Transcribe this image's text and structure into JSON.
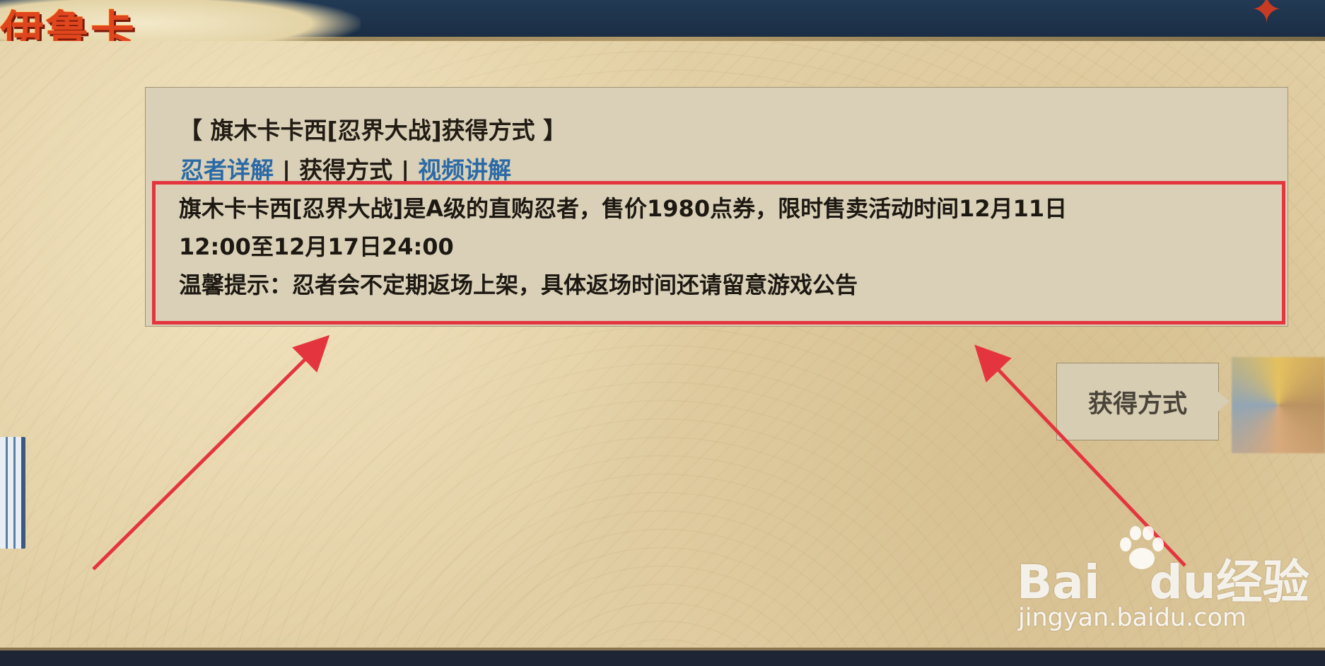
{
  "header": {
    "title_fragment": "伊鲁卡"
  },
  "panel": {
    "title": "【 旗木卡卡西[忍界大战]获得方式 】",
    "tabs": [
      {
        "label": "忍者详解",
        "type": "link"
      },
      {
        "label": "获得方式",
        "type": "current"
      },
      {
        "label": "视频讲解",
        "type": "link"
      }
    ],
    "separator": "|",
    "body_lines": [
      "旗木卡卡西[忍界大战]是A级的直购忍者，售价1980点券，限时售卖活动时间12月11日",
      "12:00至12月17日24:00",
      "温馨提示：忍者会不定期返场上架，具体返场时间还请留意游戏公告"
    ]
  },
  "side_button": {
    "label": "获得方式"
  },
  "watermark": {
    "logo_text": "Bai",
    "logo_mid": "du",
    "logo_suffix": "经验",
    "url": "jingyan.baidu.com"
  },
  "colors": {
    "highlight": "#e4353f",
    "link": "#2b6aa6",
    "parchment": "#e2cfa4",
    "title_text": "#e0461e"
  },
  "icons": {
    "corner": "star-icon",
    "watermark_paw": "paw-icon"
  }
}
